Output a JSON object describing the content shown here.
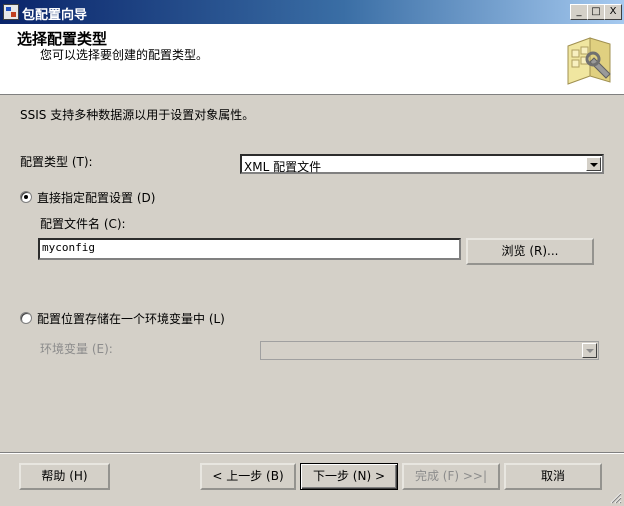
{
  "window": {
    "title": "包配置向导",
    "minimize_glyph": "_",
    "maximize_glyph": "□",
    "close_glyph": "X"
  },
  "header": {
    "title": "选择配置类型",
    "subtitle": "您可以选择要创建的配置类型。",
    "art_icon": "configuration-wizard-icon"
  },
  "body": {
    "intro": "SSIS 支持多种数据源以用于设置对象属性。",
    "config_type_label": "配置类型 (T):",
    "config_type_value": "XML 配置文件",
    "option_direct": {
      "label": "直接指定配置设置 (D)",
      "checked": true
    },
    "file_name_label": "配置文件名 (C):",
    "file_name_value": "myconfig",
    "browse_button": "浏览 (R)...",
    "option_env": {
      "label": "配置位置存储在一个环境变量中 (L)",
      "checked": false
    },
    "env_var_label": "环境变量 (E):",
    "env_var_value": ""
  },
  "footer": {
    "help_button": "帮助 (H)",
    "back_button": "< 上一步 (B)",
    "next_button": "下一步 (N) >",
    "finish_button": "完成 (F) >>|",
    "cancel_button": "取消"
  },
  "colors": {
    "titlebar_start": "#0a246a",
    "titlebar_end": "#a6caf0",
    "dialog_bg": "#d4d0c8",
    "disabled_text": "#8c8c8c"
  }
}
